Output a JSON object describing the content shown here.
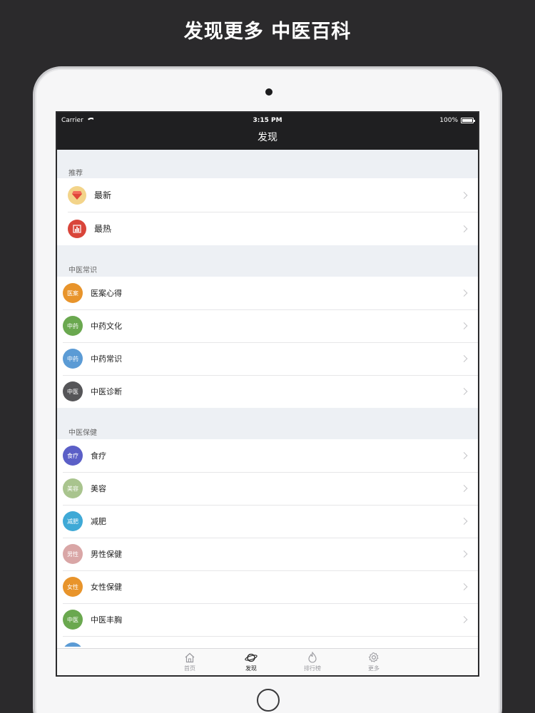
{
  "headline": "发现更多 中医百科",
  "status_bar": {
    "carrier": "Carrier",
    "time": "3:15 PM",
    "battery": "100%"
  },
  "navbar": {
    "title": "发现"
  },
  "sections": [
    {
      "header": "推荐",
      "items": [
        {
          "label": "最新",
          "icon": "diamond-icon",
          "color": "#f3d48a"
        },
        {
          "label": "最热",
          "icon": "bar-chart-icon",
          "color": "#d9453a"
        }
      ]
    },
    {
      "header": "中医常识",
      "items": [
        {
          "badge": "医案",
          "label": "医案心得",
          "color": "#e8942b"
        },
        {
          "badge": "中药",
          "label": "中药文化",
          "color": "#6aa84f"
        },
        {
          "badge": "中药",
          "label": "中药常识",
          "color": "#5b9bd5"
        },
        {
          "badge": "中医",
          "label": "中医诊断",
          "color": "#555558"
        }
      ]
    },
    {
      "header": "中医保健",
      "items": [
        {
          "badge": "食疗",
          "label": "食疗",
          "color": "#5b5fc7"
        },
        {
          "badge": "美容",
          "label": "美容",
          "color": "#a9c48e"
        },
        {
          "badge": "减肥",
          "label": "减肥",
          "color": "#3fa9d6"
        },
        {
          "badge": "男性",
          "label": "男性保健",
          "color": "#d9a6a6"
        },
        {
          "badge": "女性",
          "label": "女性保健",
          "color": "#e8942b"
        },
        {
          "badge": "中医",
          "label": "中医丰胸",
          "color": "#6aa84f"
        },
        {
          "badge": "",
          "label": "",
          "color": "#5b9bd5"
        }
      ]
    }
  ],
  "tabbar": {
    "items": [
      {
        "label": "首页",
        "icon": "home-icon"
      },
      {
        "label": "发现",
        "icon": "planet-icon",
        "active": true
      },
      {
        "label": "排行榜",
        "icon": "flame-icon"
      },
      {
        "label": "更多",
        "icon": "gear-icon"
      }
    ]
  }
}
